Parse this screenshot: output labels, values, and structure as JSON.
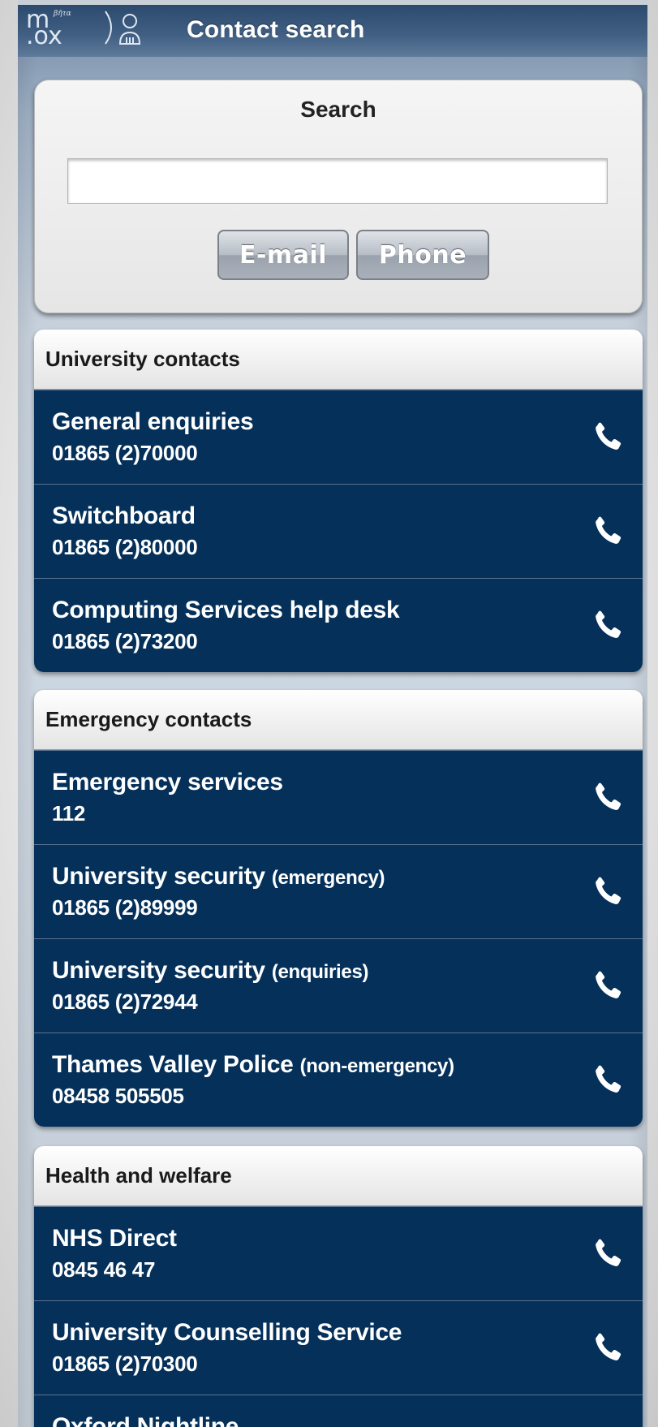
{
  "header": {
    "logo_text": "m.ox",
    "logo_badge": "βῆτα",
    "title": "Contact search"
  },
  "search": {
    "label": "Search",
    "input_value": "",
    "placeholder": "",
    "email_button": "E-mail",
    "phone_button": "Phone"
  },
  "sections": [
    {
      "title": "University contacts",
      "items": [
        {
          "name": "General enquiries",
          "qualifier": "",
          "number": "01865 (2)70000"
        },
        {
          "name": "Switchboard",
          "qualifier": "",
          "number": "01865 (2)80000"
        },
        {
          "name": "Computing Services help desk",
          "qualifier": "",
          "number": "01865 (2)73200"
        }
      ]
    },
    {
      "title": "Emergency contacts",
      "items": [
        {
          "name": "Emergency services",
          "qualifier": "",
          "number": "112"
        },
        {
          "name": "University security",
          "qualifier": "(emergency)",
          "number": "01865 (2)89999"
        },
        {
          "name": "University security",
          "qualifier": "(enquiries)",
          "number": "01865 (2)72944"
        },
        {
          "name": "Thames Valley Police",
          "qualifier": "(non-emergency)",
          "number": "08458 505505"
        }
      ]
    },
    {
      "title": "Health and welfare",
      "items": [
        {
          "name": "NHS Direct",
          "qualifier": "",
          "number": "0845 46 47"
        },
        {
          "name": "University Counselling Service",
          "qualifier": "",
          "number": "01865 (2)70300"
        },
        {
          "name": "Oxford Nightline",
          "qualifier": "",
          "number": ""
        }
      ]
    }
  ],
  "colors": {
    "row_background": "#04305a",
    "header_background": "#2c4a6d"
  },
  "icons": {
    "row_action": "phone-handset-icon",
    "header_user": "user-icon"
  }
}
